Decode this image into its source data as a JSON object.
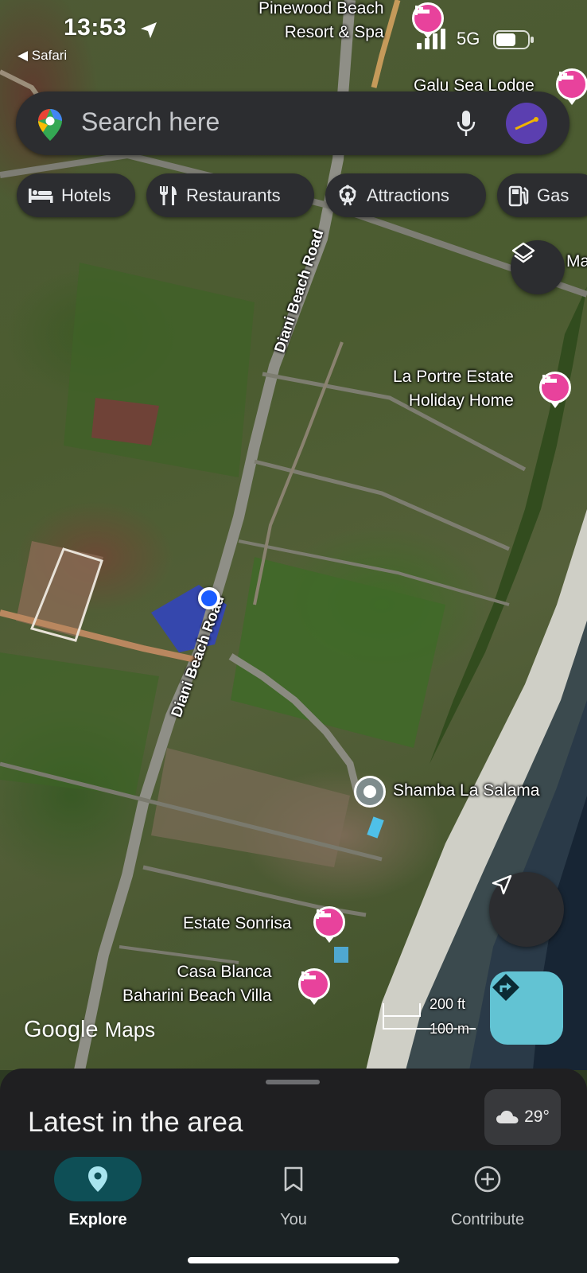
{
  "status_bar": {
    "time": "13:53",
    "back_app": "◀ Safari",
    "network": "5G"
  },
  "search": {
    "placeholder": "Search here"
  },
  "chips": [
    {
      "label": "Hotels",
      "icon": "bed-icon"
    },
    {
      "label": "Restaurants",
      "icon": "fork-knife-icon"
    },
    {
      "label": "Attractions",
      "icon": "ferris-wheel-icon"
    },
    {
      "label": "Gas",
      "icon": "gas-pump-icon"
    }
  ],
  "map": {
    "places": {
      "pinewood": "Pinewood Beach\nResort & Spa",
      "galu": "Galu Sea Lodge",
      "laportre": "La Portre Estate\nHoliday Home",
      "shamba": "Shamba La Salama",
      "sonrisa": "Estate Sonrisa",
      "casablanca": "Casa Blanca\nBaharini Beach Villa",
      "edge_label": "Ma"
    },
    "roads": {
      "upper": "Diani Beach Road",
      "lower": "Diani Beach Road"
    },
    "scale": {
      "feet": "200 ft",
      "meters": "100 m"
    },
    "logo": {
      "google": "Google",
      "maps": "Maps"
    }
  },
  "sheet": {
    "title": "Latest in the area",
    "weather": "29°"
  },
  "nav": [
    {
      "label": "Explore",
      "icon": "location-pin-icon",
      "active": true
    },
    {
      "label": "You",
      "icon": "bookmark-icon",
      "active": false
    },
    {
      "label": "Contribute",
      "icon": "add-circle-icon",
      "active": false
    }
  ],
  "colors": {
    "hotel_pin": "#e8429c",
    "directions_button": "#62c3d3",
    "nav_active": "#0e4f56",
    "location_dot": "#1a5cff"
  }
}
